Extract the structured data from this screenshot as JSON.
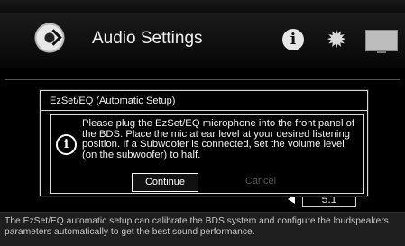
{
  "header": {
    "title": "Audio Settings",
    "icons": {
      "disc": "disc-icon",
      "info": "info-icon",
      "settings": "gear-icon",
      "display": "tv-icon"
    },
    "info_glyph": "i",
    "gear_glyph": "✹"
  },
  "background": {
    "value_text": "5.1"
  },
  "dialog": {
    "title": "EzSet/EQ (Automatic Setup)",
    "info_glyph": "i",
    "message": "Please plug the EzSet/EQ microphone into the front panel of the BDS. Place the mic at ear level at your desired listening position. If a Subwoofer is connected, set the volume level (on the subwoofer) to half.",
    "buttons": {
      "continue": "Continue",
      "cancel": "Cancel"
    }
  },
  "footer": {
    "description": "The EzSet/EQ automatic setup can calibrate the BDS system and configure the loudspeakers parameters automatically to get the best sound performance."
  },
  "colors": {
    "background": "#000000",
    "text": "#ffffff",
    "disabled_text": "#555555"
  }
}
